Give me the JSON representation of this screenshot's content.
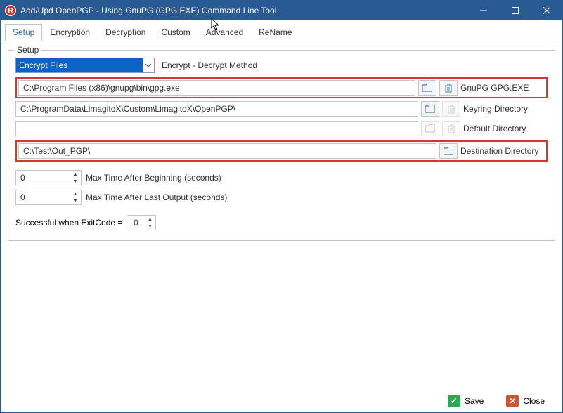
{
  "title": "Add/Upd OpenPGP - Using GnuPG (GPG.EXE) Command Line Tool",
  "tabs": [
    "Setup",
    "Encryption",
    "Decryption",
    "Custom",
    "Advanced",
    "ReName"
  ],
  "active_tab": 0,
  "group_label": "Setup",
  "method": {
    "value": "Encrypt Files",
    "label": "Encrypt - Decrypt Method"
  },
  "paths": {
    "gpg": {
      "value": "C:\\Program Files (x86)\\gnupg\\bin\\gpg.exe",
      "label": "GnuPG GPG.EXE"
    },
    "keyring": {
      "value": "C:\\ProgramData\\LimagitoX\\Custom\\LimagitoX\\OpenPGP\\",
      "label": "Keyring Directory"
    },
    "default": {
      "value": "",
      "label": "Default Directory"
    },
    "dest": {
      "value": "C:\\Test\\Out_PGP\\",
      "label": "Destination Directory"
    }
  },
  "timing": {
    "begin": {
      "value": "0",
      "label": "Max Time After Beginning (seconds)"
    },
    "last": {
      "value": "0",
      "label": "Max Time After Last Output (seconds)"
    }
  },
  "exitcode": {
    "label": "Successful when ExitCode =",
    "value": "0"
  },
  "buttons": {
    "save": "Save",
    "close": "Close"
  }
}
